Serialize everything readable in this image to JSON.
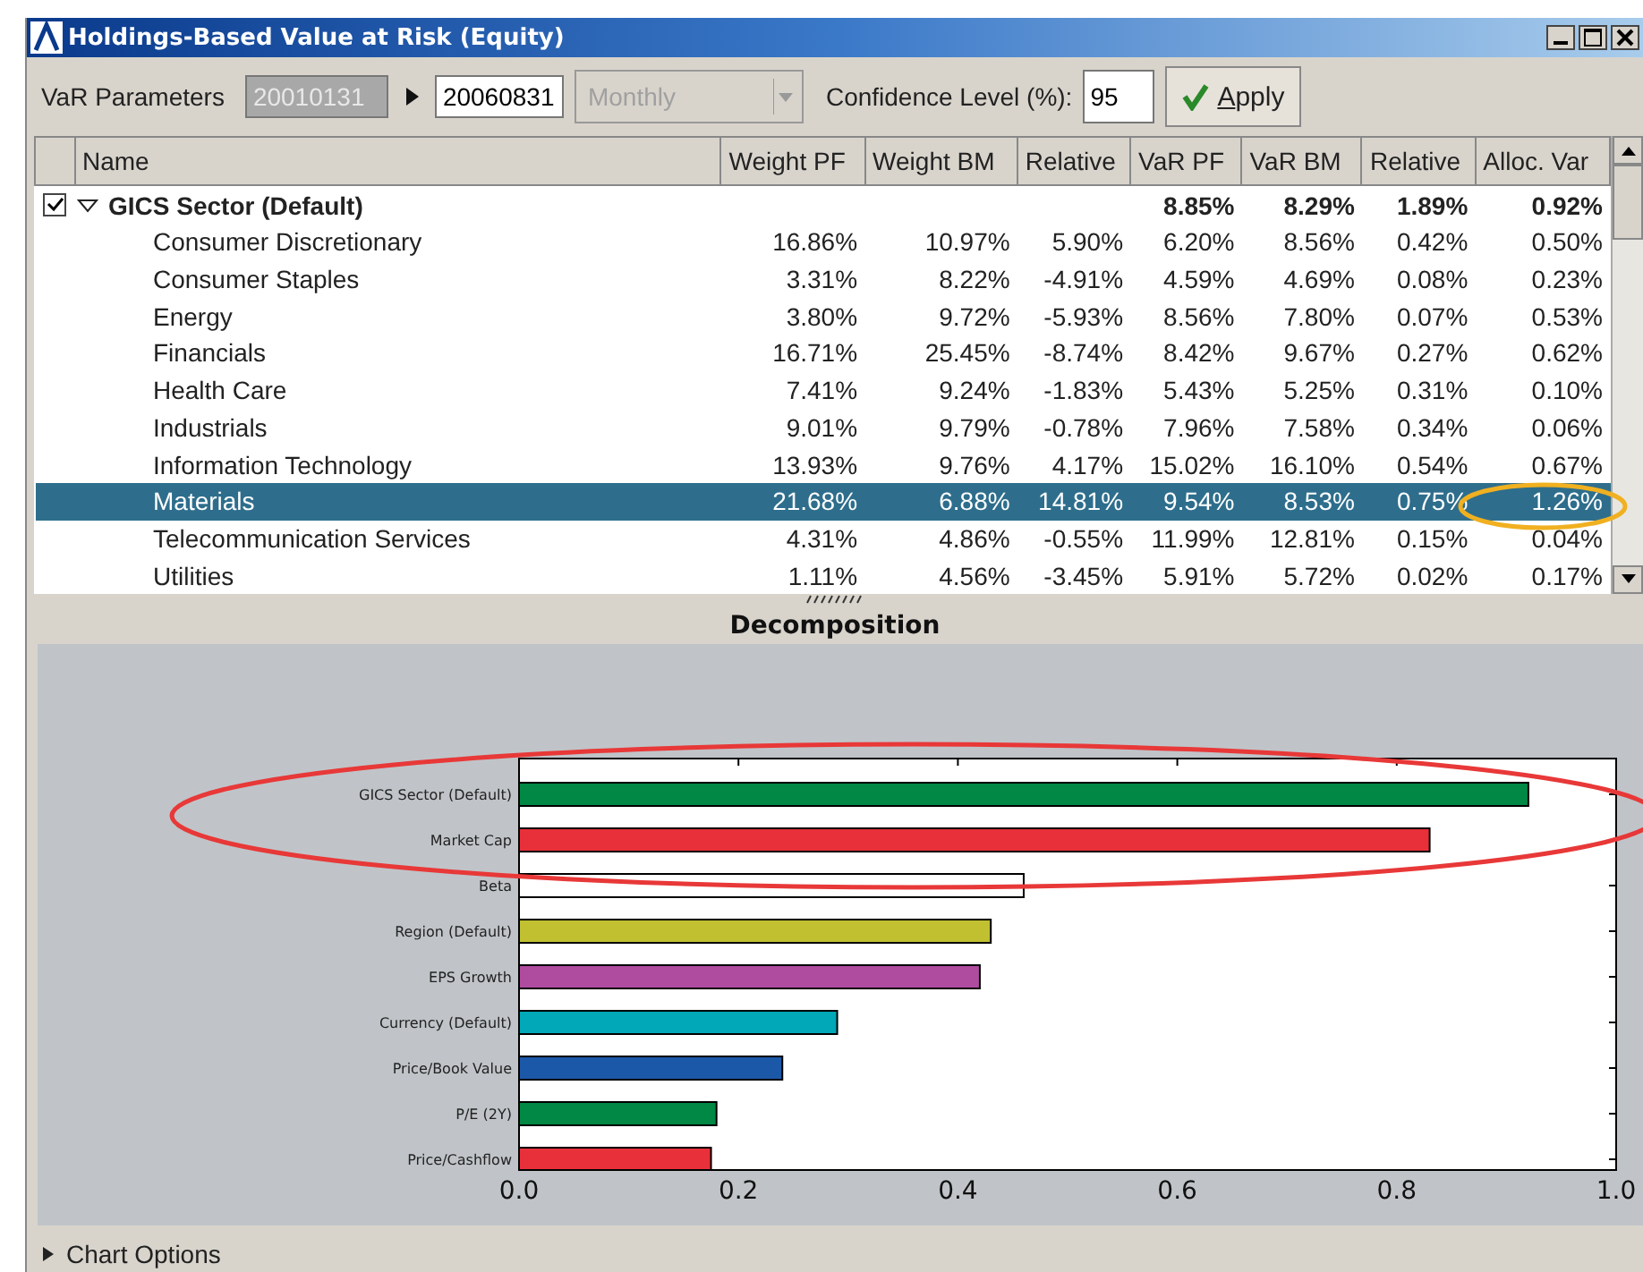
{
  "window": {
    "title": "Holdings-Based Value at Risk (Equity)"
  },
  "parameters": {
    "label": "VaR Parameters",
    "start_date": "20010131",
    "end_date": "20060831",
    "frequency": "Monthly",
    "confidence_label": "Confidence Level (%):",
    "confidence": "95",
    "apply": "Apply"
  },
  "table": {
    "columns": [
      "Name",
      "Weight PF",
      "Weight BM",
      "Relative",
      "VaR PF",
      "VaR BM",
      "Relative",
      "Alloc. Var"
    ],
    "group": {
      "checked": true,
      "expanded": true,
      "cells": [
        "GICS Sector (Default)",
        "",
        "",
        "",
        "8.85%",
        "8.29%",
        "1.89%",
        "0.92%"
      ]
    },
    "rows": [
      {
        "selected": false,
        "cells": [
          "Consumer Discretionary",
          "16.86%",
          "10.97%",
          "5.90%",
          "6.20%",
          "8.56%",
          "0.42%",
          "0.50%"
        ]
      },
      {
        "selected": false,
        "cells": [
          "Consumer Staples",
          "3.31%",
          "8.22%",
          "-4.91%",
          "4.59%",
          "4.69%",
          "0.08%",
          "0.23%"
        ]
      },
      {
        "selected": false,
        "cells": [
          "Energy",
          "3.80%",
          "9.72%",
          "-5.93%",
          "8.56%",
          "7.80%",
          "0.07%",
          "0.53%"
        ]
      },
      {
        "selected": false,
        "cells": [
          "Financials",
          "16.71%",
          "25.45%",
          "-8.74%",
          "8.42%",
          "9.67%",
          "0.27%",
          "0.62%"
        ]
      },
      {
        "selected": false,
        "cells": [
          "Health Care",
          "7.41%",
          "9.24%",
          "-1.83%",
          "5.43%",
          "5.25%",
          "0.31%",
          "0.10%"
        ]
      },
      {
        "selected": false,
        "cells": [
          "Industrials",
          "9.01%",
          "9.79%",
          "-0.78%",
          "7.96%",
          "7.58%",
          "0.34%",
          "0.06%"
        ]
      },
      {
        "selected": false,
        "cells": [
          "Information Technology",
          "13.93%",
          "9.76%",
          "4.17%",
          "15.02%",
          "16.10%",
          "0.54%",
          "0.67%"
        ]
      },
      {
        "selected": true,
        "cells": [
          "Materials",
          "21.68%",
          "6.88%",
          "14.81%",
          "9.54%",
          "8.53%",
          "0.75%",
          "1.26%"
        ]
      },
      {
        "selected": false,
        "cells": [
          "Telecommunication Services",
          "4.31%",
          "4.86%",
          "-0.55%",
          "11.99%",
          "12.81%",
          "0.15%",
          "0.04%"
        ]
      },
      {
        "selected": false,
        "cells": [
          "Utilities",
          "1.11%",
          "4.56%",
          "-3.45%",
          "5.91%",
          "5.72%",
          "0.02%",
          "0.17%"
        ]
      }
    ]
  },
  "decomposition": {
    "title": "Decomposition",
    "chart_data": {
      "type": "bar",
      "orientation": "horizontal",
      "categories": [
        "GICS Sector (Default)",
        "Market Cap",
        "Beta",
        "Region (Default)",
        "EPS Growth",
        "Currency (Default)",
        "Price/Book Value",
        "P/E (2Y)",
        "Price/Cashflow"
      ],
      "values": [
        0.92,
        0.83,
        0.46,
        0.43,
        0.42,
        0.29,
        0.24,
        0.18,
        0.175
      ],
      "colors": [
        "#008844",
        "#e8303a",
        "#ffffff",
        "#c0c030",
        "#b04ca0",
        "#00a8b8",
        "#1c58a8",
        "#008844",
        "#e8303a"
      ],
      "xlim": [
        0,
        1
      ],
      "xticks": [
        {
          "value": 0,
          "label": "0.0"
        },
        {
          "value": 0.2,
          "label": "0.2"
        },
        {
          "value": 0.4,
          "label": "0.4"
        },
        {
          "value": 0.6,
          "label": "0.6"
        },
        {
          "value": 0.8,
          "label": "0.8"
        },
        {
          "value": 1,
          "label": "1.0"
        }
      ]
    }
  },
  "chart_options": {
    "label": "Chart Options",
    "expanded": false
  }
}
